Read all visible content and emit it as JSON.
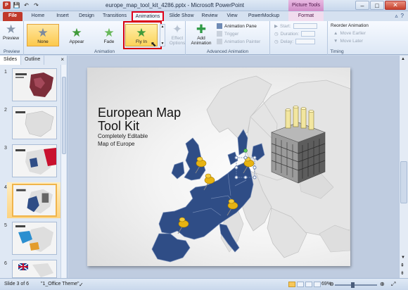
{
  "window": {
    "title": "europe_map_tool_kit_4286.pptx - Microsoft PowerPoint",
    "context_tab": "Picture Tools",
    "controls": {
      "minimize": "–",
      "maximize": "□",
      "close": "✕"
    }
  },
  "qat": {
    "app": "P",
    "save": "💾",
    "undo": "↶",
    "redo": "↷"
  },
  "tabs": [
    "File",
    "Home",
    "Insert",
    "Design",
    "Transitions",
    "Animations",
    "Slide Show",
    "Review",
    "View",
    "PowerMockup",
    "Format"
  ],
  "ribbon": {
    "preview": {
      "label": "Preview",
      "group": "Preview"
    },
    "animation": {
      "group": "Animation",
      "items": [
        "None",
        "Appear",
        "Fade",
        "Fly In"
      ],
      "effect_options": "Effect Options"
    },
    "advanced": {
      "group": "Advanced Animation",
      "add_animation": "Add Animation",
      "animation_pane": "Animation Pane",
      "trigger": "Trigger",
      "animation_painter": "Animation Painter"
    },
    "timing": {
      "group": "Timing",
      "start": "Start:",
      "duration": "Duration:",
      "delay": "Delay:",
      "reorder": "Reorder Animation",
      "move_earlier": "Move Earlier",
      "move_later": "Move Later"
    }
  },
  "pane": {
    "tabs": [
      "Slides",
      "Outline"
    ],
    "close": "×",
    "slide_numbers": [
      "1",
      "2",
      "3",
      "4",
      "5",
      "6"
    ]
  },
  "slide": {
    "title_line1": "European Map",
    "title_line2": "Tool Kit",
    "subtitle_line1": "Completely Editable",
    "subtitle_line2": "Map of Europe"
  },
  "status": {
    "slide": "Slide 3 of 6",
    "theme": "\"1_Office Theme\"",
    "zoom": "69%"
  },
  "colors": {
    "map_blue": "#2f4d86",
    "map_gray": "#e3e3e3",
    "file_red": "#c0392b",
    "highlight": "#d7000f"
  }
}
